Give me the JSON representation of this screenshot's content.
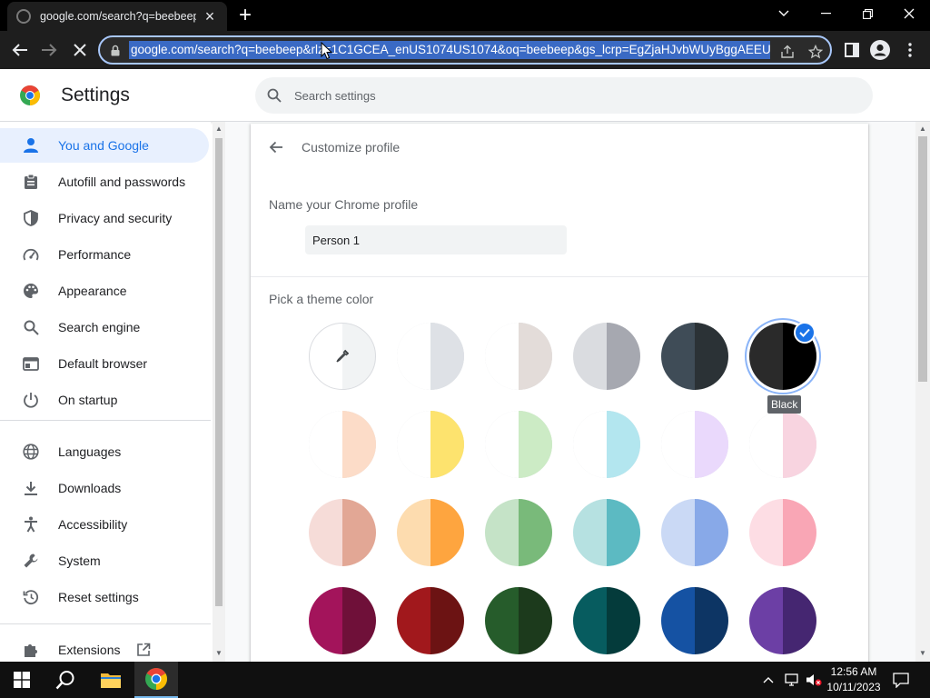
{
  "browser": {
    "tab_title": "google.com/search?q=beebeep&",
    "tab_close": "×",
    "new_tab": "+",
    "url": "google.com/search?q=beebeep&rlz=1C1GCEA_enUS1074US1074&oq=beebeep&gs_lcrp=EgZjaHJvbWUyBggAEEU"
  },
  "settings": {
    "title": "Settings",
    "search_placeholder": "Search settings"
  },
  "sidebar": {
    "items": [
      {
        "label": "You and Google",
        "icon": "person-icon"
      },
      {
        "label": "Autofill and passwords",
        "icon": "clipboard-icon"
      },
      {
        "label": "Privacy and security",
        "icon": "shield-icon"
      },
      {
        "label": "Performance",
        "icon": "speedometer-icon"
      },
      {
        "label": "Appearance",
        "icon": "palette-icon"
      },
      {
        "label": "Search engine",
        "icon": "search-icon"
      },
      {
        "label": "Default browser",
        "icon": "browser-window-icon"
      },
      {
        "label": "On startup",
        "icon": "power-icon"
      },
      {
        "label": "Languages",
        "icon": "globe-icon"
      },
      {
        "label": "Downloads",
        "icon": "download-icon"
      },
      {
        "label": "Accessibility",
        "icon": "accessibility-icon"
      },
      {
        "label": "System",
        "icon": "wrench-icon"
      },
      {
        "label": "Reset settings",
        "icon": "reset-history-icon"
      },
      {
        "label": "Extensions",
        "icon": "puzzle-icon"
      }
    ]
  },
  "profile": {
    "page_title": "Customize profile",
    "name_label": "Name your Chrome profile",
    "name_value": "Person 1",
    "theme_label": "Pick a theme color",
    "selected_tooltip": "Black"
  },
  "theme_colors": [
    {
      "left": "#ffffff",
      "right": "#dee1e6"
    },
    {
      "left": "#ffffff",
      "right": "#e3dcd9"
    },
    {
      "left": "#dadce0",
      "right": "#a6a8b0"
    },
    {
      "left": "#3f4c57",
      "right": "#2b3236"
    },
    {
      "left": "#2a2a2a",
      "right": "#000000"
    },
    {
      "left": "#ffffff",
      "right": "#fcdcc8"
    },
    {
      "left": "#ffffff",
      "right": "#fde36e"
    },
    {
      "left": "#ffffff",
      "right": "#ccebc5"
    },
    {
      "left": "#ffffff",
      "right": "#b3e6ef"
    },
    {
      "left": "#ffffff",
      "right": "#ead9fc"
    },
    {
      "left": "#ffffff",
      "right": "#f8d4e0"
    },
    {
      "left": "#f6dcd8",
      "right": "#e2a795"
    },
    {
      "left": "#fddcaf",
      "right": "#fea53f"
    },
    {
      "left": "#c5e3c7",
      "right": "#79ba7a"
    },
    {
      "left": "#b6e1e1",
      "right": "#5cbac2"
    },
    {
      "left": "#cad9f5",
      "right": "#88a9e8"
    },
    {
      "left": "#fddde4",
      "right": "#f9a6b5"
    },
    {
      "left": "#a3145b",
      "right": "#6f1039"
    },
    {
      "left": "#a1181c",
      "right": "#6c1313"
    },
    {
      "left": "#265c2b",
      "right": "#1c3a1c"
    },
    {
      "left": "#075c5f",
      "right": "#043b3b"
    },
    {
      "left": "#1552a3",
      "right": "#0d3564"
    },
    {
      "left": "#6c3fa5",
      "right": "#452671"
    }
  ],
  "taskbar": {
    "time": "12:56 AM",
    "date": "10/11/2023"
  }
}
